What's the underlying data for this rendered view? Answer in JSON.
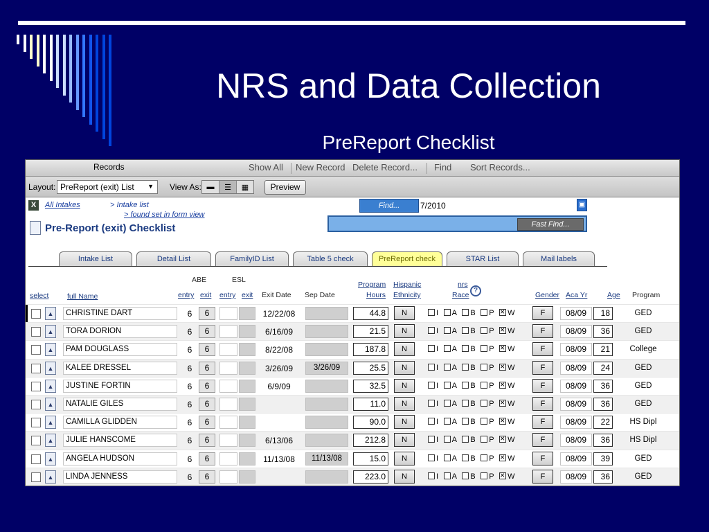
{
  "slide": {
    "title": "NRS and Data Collection",
    "subtitle": "PreReport Checklist",
    "bar_colors": [
      "#ffffff",
      "#ffffff",
      "#ffffcc",
      "#ffffcc",
      "#ffffff",
      "#ffffff",
      "#ccddff",
      "#ccddff",
      "#99bbff",
      "#6699ff",
      "#3377ff",
      "#1155ee",
      "#0044dd",
      "#0044dd",
      "#0044dd"
    ]
  },
  "toolbar": {
    "records": "Records",
    "show_all": "Show All",
    "new_record": "New Record",
    "delete_record": "Delete Record...",
    "find": "Find",
    "sort_records": "Sort Records..."
  },
  "layout_bar": {
    "layout_label": "Layout:",
    "layout_value": "PreReport (exit) List",
    "view_as_label": "View As:",
    "preview": "Preview"
  },
  "nav": {
    "all_intakes": "All Intakes",
    "intake_list": "> Intake list",
    "found_set": "> found set in form view",
    "find_button": "Find...",
    "find_date": "7/2010",
    "fast_find": "Fast Find...",
    "page_title": "Pre-Report (exit) Checklist"
  },
  "tabs": [
    "Intake List",
    "Detail List",
    "FamilyID List",
    "Table 5 check",
    "PreReport check",
    "STAR List",
    "Mail labels"
  ],
  "active_tab": "PreReport check",
  "headers": {
    "abe": "ABE",
    "esl": "ESL",
    "select": "select",
    "full_name": "full Name",
    "entry": "entry",
    "exit": "exit",
    "entry2": "entry",
    "exit2": "exit",
    "exit_date": "Exit Date",
    "sep_date": "Sep Date",
    "program": "Program",
    "hours": "Hours",
    "hispanic": "Hispanic",
    "ethnicity": "Ethnicity",
    "nrs": "nrs",
    "race": "Race",
    "help": "?",
    "gender": "Gender",
    "aca_yr": "Aca Yr",
    "age": "Age",
    "program_col": "Program"
  },
  "race_labels": [
    "I",
    "A",
    "B",
    "P",
    "W"
  ],
  "rows": [
    {
      "name": "CHRISTINE DART",
      "abe_entry": "6",
      "abe_exit": "6",
      "exit_date": "12/22/08",
      "sep_date": "",
      "hours": "44.8",
      "ethnicity": "N",
      "gender": "F",
      "aca_yr": "08/09",
      "age": "18",
      "program": "GED"
    },
    {
      "name": "TORA DORION",
      "abe_entry": "6",
      "abe_exit": "6",
      "exit_date": "6/16/09",
      "sep_date": "",
      "hours": "21.5",
      "ethnicity": "N",
      "gender": "F",
      "aca_yr": "08/09",
      "age": "36",
      "program": "GED"
    },
    {
      "name": "PAM DOUGLASS",
      "abe_entry": "6",
      "abe_exit": "6",
      "exit_date": "8/22/08",
      "sep_date": "",
      "hours": "187.8",
      "ethnicity": "N",
      "gender": "F",
      "aca_yr": "08/09",
      "age": "21",
      "program": "College"
    },
    {
      "name": "KALEE DRESSEL",
      "abe_entry": "6",
      "abe_exit": "6",
      "exit_date": "3/26/09",
      "sep_date": "3/26/09",
      "hours": "25.5",
      "ethnicity": "N",
      "gender": "F",
      "aca_yr": "08/09",
      "age": "24",
      "program": "GED"
    },
    {
      "name": "JUSTINE FORTIN",
      "abe_entry": "6",
      "abe_exit": "6",
      "exit_date": "6/9/09",
      "sep_date": "",
      "hours": "32.5",
      "ethnicity": "N",
      "gender": "F",
      "aca_yr": "08/09",
      "age": "36",
      "program": "GED"
    },
    {
      "name": "NATALIE GILES",
      "abe_entry": "6",
      "abe_exit": "6",
      "exit_date": "",
      "sep_date": "",
      "hours": "11.0",
      "ethnicity": "N",
      "gender": "F",
      "aca_yr": "08/09",
      "age": "36",
      "program": "GED"
    },
    {
      "name": "CAMILLA GLIDDEN",
      "abe_entry": "6",
      "abe_exit": "6",
      "exit_date": "",
      "sep_date": "",
      "hours": "90.0",
      "ethnicity": "N",
      "gender": "F",
      "aca_yr": "08/09",
      "age": "22",
      "program": "HS Dipl"
    },
    {
      "name": "JULIE HANSCOME",
      "abe_entry": "6",
      "abe_exit": "6",
      "exit_date": "6/13/06",
      "sep_date": "",
      "hours": "212.8",
      "ethnicity": "N",
      "gender": "F",
      "aca_yr": "08/09",
      "age": "36",
      "program": "HS Dipl"
    },
    {
      "name": "ANGELA HUDSON",
      "abe_entry": "6",
      "abe_exit": "6",
      "exit_date": "11/13/08",
      "sep_date": "11/13/08",
      "hours": "15.0",
      "ethnicity": "N",
      "gender": "F",
      "aca_yr": "08/09",
      "age": "39",
      "program": "GED"
    },
    {
      "name": "LINDA JENNESS",
      "abe_entry": "6",
      "abe_exit": "6",
      "exit_date": "",
      "sep_date": "",
      "hours": "223.0",
      "ethnicity": "N",
      "gender": "F",
      "aca_yr": "08/09",
      "age": "36",
      "program": "GED"
    }
  ]
}
